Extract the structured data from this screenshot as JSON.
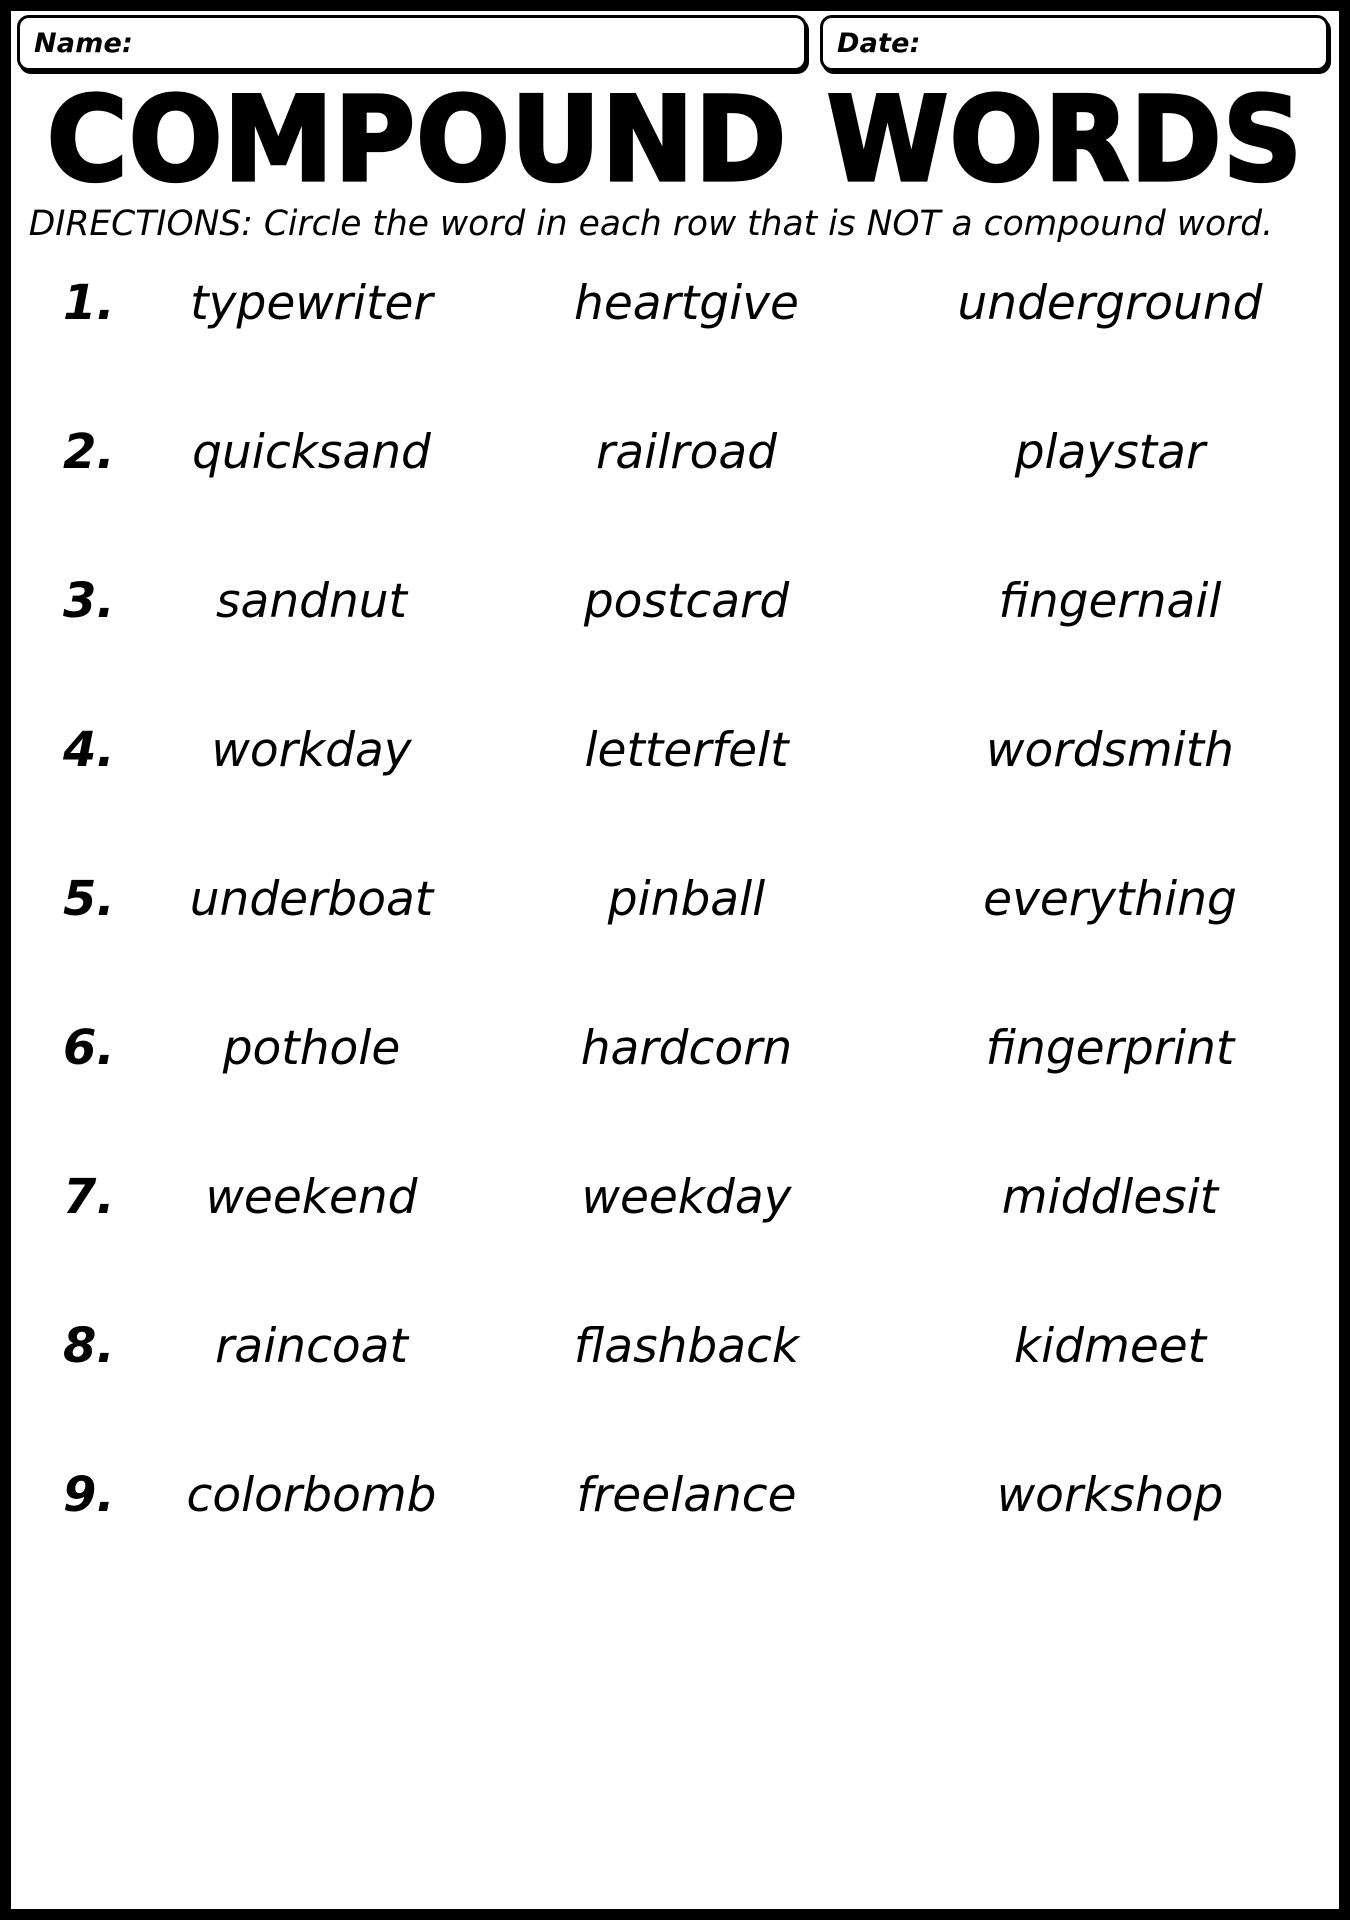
{
  "page": {
    "border_color": "#000000",
    "background_color": "#ffffff",
    "text_color": "#000000"
  },
  "header": {
    "name_label": "Name:",
    "date_label": "Date:",
    "name_value": "",
    "date_value": ""
  },
  "title": "COMPOUND WORDS",
  "directions": "DIRECTIONS: Circle the word in each row that is NOT a compound word.",
  "rows": [
    {
      "number": "1.",
      "words": [
        "typewriter",
        "heartgive",
        "underground"
      ]
    },
    {
      "number": "2.",
      "words": [
        "quicksand",
        "railroad",
        "playstar"
      ]
    },
    {
      "number": "3.",
      "words": [
        "sandnut",
        "postcard",
        "fingernail"
      ]
    },
    {
      "number": "4.",
      "words": [
        "workday",
        "letterfelt",
        "wordsmith"
      ]
    },
    {
      "number": "5.",
      "words": [
        "underboat",
        "pinball",
        "everything"
      ]
    },
    {
      "number": "6.",
      "words": [
        "pothole",
        "hardcorn",
        "fingerprint"
      ]
    },
    {
      "number": "7.",
      "words": [
        "weekend",
        "weekday",
        "middlesit"
      ]
    },
    {
      "number": "8.",
      "words": [
        "raincoat",
        "flashback",
        "kidmeet"
      ]
    },
    {
      "number": "9.",
      "words": [
        "colorbomb",
        "freelance",
        "workshop"
      ]
    }
  ]
}
